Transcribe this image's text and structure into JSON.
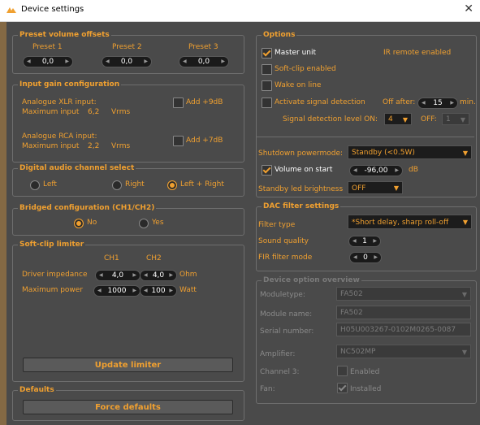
{
  "window": {
    "title": "Device settings",
    "close_glyph": "✕"
  },
  "preset_volume": {
    "legend": "Preset volume offsets",
    "labels": [
      "Preset 1",
      "Preset 2",
      "Preset 3"
    ],
    "values": [
      "0,0",
      "0,0",
      "0,0"
    ]
  },
  "input_gain": {
    "legend": "Input gain configuration",
    "xlr_label": "Analogue XLR input:",
    "xlr_max_label": "Maximum input",
    "xlr_max_value": "6,2",
    "xlr_unit": "Vrms",
    "xlr_add_label": "Add +9dB",
    "rca_label": "Analogue RCA input:",
    "rca_max_label": "Maximum input",
    "rca_max_value": "2,2",
    "rca_unit": "Vrms",
    "rca_add_label": "Add +7dB"
  },
  "digital_channel": {
    "legend": "Digital audio channel select",
    "options": [
      "Left",
      "Right",
      "Left + Right"
    ],
    "selected": "Left + Right"
  },
  "bridged": {
    "legend": "Bridged configuration (CH1/CH2)",
    "options": [
      "No",
      "Yes"
    ],
    "selected": "No"
  },
  "softclip": {
    "legend": "Soft-clip limiter",
    "col1": "CH1",
    "col2": "CH2",
    "impedance_label": "Driver impedance",
    "impedance_ch1": "4,0",
    "impedance_ch2": "4,0",
    "impedance_unit": "Ohm",
    "power_label": "Maximum power",
    "power_ch1": "1000",
    "power_ch2": "100",
    "power_unit": "Watt",
    "update_button": "Update limiter"
  },
  "defaults": {
    "legend": "Defaults",
    "button": "Force defaults"
  },
  "options": {
    "legend": "Options",
    "master_unit": "Master unit",
    "ir_remote": "IR remote enabled",
    "softclip_enabled": "Soft-clip enabled",
    "wake_on_line": "Wake on line",
    "activate_signal": "Activate signal detection",
    "off_after_label": "Off after:",
    "off_after_value": "15",
    "off_after_unit": "min.",
    "signal_level_on_label": "Signal detection level ON:",
    "signal_level_on_value": "4",
    "signal_level_off_label": "OFF:",
    "signal_level_off_value": "1",
    "shutdown_label": "Shutdown powermode:",
    "shutdown_value": "Standby (<0.5W)",
    "volume_on_start_label": "Volume on start",
    "volume_on_start_value": "-96,00",
    "volume_on_start_unit": "dB",
    "standby_led_label": "Standby led brightness",
    "standby_led_value": "OFF"
  },
  "dac": {
    "legend": "DAC filter settings",
    "filter_type_label": "Filter type",
    "filter_type_value": "*Short delay, sharp roll-off",
    "sound_quality_label": "Sound quality",
    "sound_quality_value": "1",
    "fir_label": "FIR filter mode",
    "fir_value": "0"
  },
  "device_overview": {
    "legend": "Device option overview",
    "moduletype_label": "Moduletype:",
    "moduletype_value": "FA502",
    "module_name_label": "Module name:",
    "module_name_value": "FA502",
    "serial_label": "Serial number:",
    "serial_value": "H05U003267-0102M0265-0087",
    "amplifier_label": "Amplifier:",
    "amplifier_value": "NC502MP",
    "channel3_label": "Channel 3:",
    "channel3_value": "Enabled",
    "fan_label": "Fan:",
    "fan_value": "Installed"
  },
  "colors": {
    "accent": "#f0a030",
    "panel_bg": "#4a4a4a",
    "field_bg": "#1a1a1a"
  }
}
